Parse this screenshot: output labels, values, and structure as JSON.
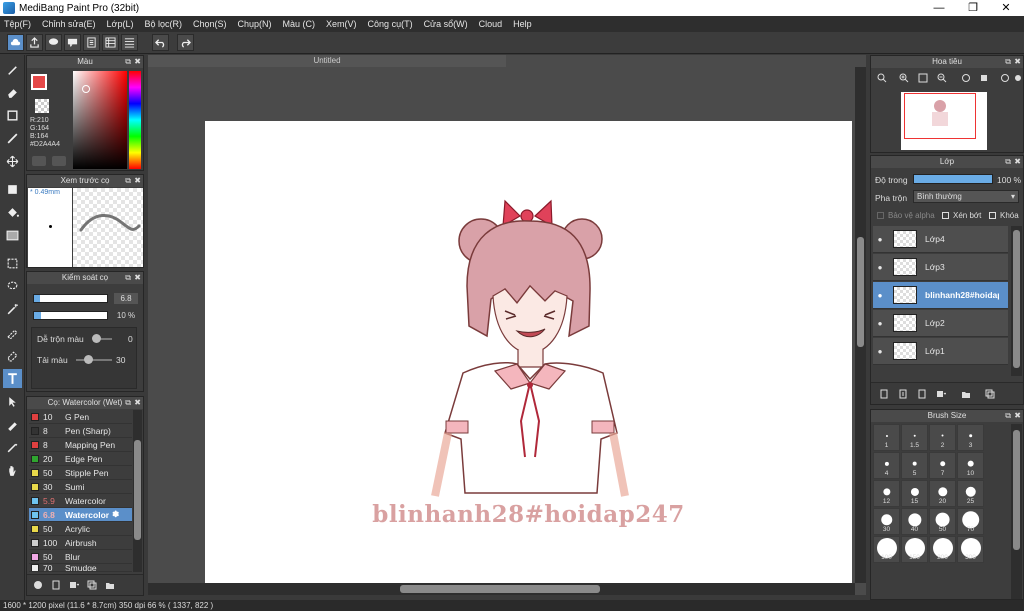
{
  "window": {
    "title": "MediBang Paint Pro (32bit)",
    "minimize_glyph": "—",
    "maximize_glyph": "❐",
    "close_glyph": "✕"
  },
  "menu": [
    "Tệp(F)",
    "Chỉnh sửa(E)",
    "Lớp(L)",
    "Bộ lọc(R)",
    "Chọn(S)",
    "Chụp(N)",
    "Màu (C)",
    "Xem(V)",
    "Công cụ(T)",
    "Cửa sổ(W)",
    "Cloud",
    "Help"
  ],
  "document": {
    "tab": "Untitled",
    "signature": "blinhanh28#hoidap247"
  },
  "color_panel": {
    "title": "Màu",
    "r": "R:210",
    "g": "G:164",
    "b": "B:164",
    "hex": "#D2A4A4",
    "main_color": "#d2a4a4",
    "fg_swatch": "#e54848"
  },
  "preview_panel": {
    "title": "Xem trước cọ",
    "size": "* 0.49mm"
  },
  "brush_control": {
    "title": "Kiểm soát cọ",
    "size_value": "6.8",
    "size_fraction": 0.08,
    "opacity_value": "10 %",
    "opacity_fraction": 0.1,
    "blend_label": "Dễ trộn màu",
    "blend_value": "0",
    "reload_label": "Tải màu",
    "reload_value": "30"
  },
  "brush_list": {
    "title": "Cọ: Watercolor (Wet)",
    "items": [
      {
        "size": "10",
        "name": "G Pen",
        "color": "#e04040"
      },
      {
        "size": "8",
        "name": "Pen (Sharp)",
        "color": "#333333"
      },
      {
        "size": "8",
        "name": "Mapping Pen",
        "color": "#e04040"
      },
      {
        "size": "20",
        "name": "Edge Pen",
        "color": "#2fa52f"
      },
      {
        "size": "50",
        "name": "Stipple Pen",
        "color": "#e8d84a"
      },
      {
        "size": "30",
        "name": "Sumi",
        "color": "#e8d84a"
      },
      {
        "size": "5.9",
        "name": "Watercolor",
        "color": "#6fc3ef"
      },
      {
        "size": "6.8",
        "name": "Watercolor",
        "color": "#6fc3ef"
      },
      {
        "size": "50",
        "name": "Acrylic",
        "color": "#e8d84a"
      },
      {
        "size": "100",
        "name": "Airbrush",
        "color": "#cccccc"
      },
      {
        "size": "50",
        "name": "Blur",
        "color": "#f2a8e6"
      },
      {
        "size": "70",
        "name": "Smudge",
        "color": "#eeeeee"
      }
    ]
  },
  "navigator": {
    "title": "Hoa tiêu"
  },
  "layer_panel": {
    "title": "Lớp",
    "opacity_label": "Độ trong",
    "opacity_value": "100 %",
    "opacity_fraction": 1.0,
    "blend_label": "Pha trộn",
    "blend_value": "Bình thường",
    "protect_alpha": "Bảo vệ alpha",
    "clipping": "Xén bớt",
    "lock": "Khóa",
    "layers": [
      {
        "name": "Lớp4",
        "selected": false
      },
      {
        "name": "Lớp3",
        "selected": false
      },
      {
        "name": "blinhanh28#hoidap247",
        "selected": true
      },
      {
        "name": "Lớp2",
        "selected": false
      },
      {
        "name": "Lớp1",
        "selected": false
      }
    ]
  },
  "brush_size_panel": {
    "title": "Brush Size",
    "sizes": [
      "1",
      "1.5",
      "2",
      "3",
      "4",
      "5",
      "7",
      "10",
      "12",
      "15",
      "20",
      "25",
      "30",
      "40",
      "50",
      "70",
      "100",
      "150",
      "200",
      "300"
    ]
  },
  "status": {
    "text": "1600 * 1200 pixel   (11.6 * 8.7cm)   350 dpi   66 %   ( 1337, 822 )"
  }
}
